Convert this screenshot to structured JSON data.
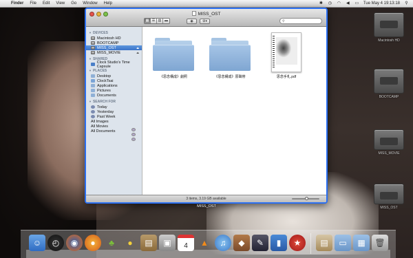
{
  "menubar": {
    "apple": "",
    "items": [
      "Finder",
      "File",
      "Edit",
      "View",
      "Go",
      "Window",
      "Help"
    ],
    "clock": "Tue May 4  19:13:18"
  },
  "window": {
    "title": "MISS_OST",
    "search_placeholder": "",
    "status": "3 items, 3.19 GB available",
    "zoom_level": 0.55
  },
  "sidebar": {
    "sections": [
      {
        "title": "DEVICES",
        "items": [
          {
            "label": "Macintosh HD",
            "icon": "disk-icon"
          },
          {
            "label": "BOOTCAMP",
            "icon": "disk-icon"
          },
          {
            "label": "MISS_OST",
            "icon": "disk-icon",
            "selected": true,
            "eject": true
          },
          {
            "label": "MISS_MOVIE",
            "icon": "disk-icon",
            "eject": true
          }
        ]
      },
      {
        "title": "SHARED",
        "items": [
          {
            "label": "Clock Studio's Time Capsule",
            "icon": "network-icon"
          }
        ]
      },
      {
        "title": "PLACES",
        "items": [
          {
            "label": "Desktop",
            "icon": "folder-icon"
          },
          {
            "label": "ClockTsai",
            "icon": "home-icon"
          },
          {
            "label": "Applications",
            "icon": "folder-icon"
          },
          {
            "label": "Pictures",
            "icon": "folder-icon"
          },
          {
            "label": "Documents",
            "icon": "folder-icon"
          }
        ]
      },
      {
        "title": "SEARCH FOR",
        "items": [
          {
            "label": "Today",
            "icon": "clock-icon"
          },
          {
            "label": "Yesterday",
            "icon": "clock-icon"
          },
          {
            "label": "Past Week",
            "icon": "clock-icon"
          },
          {
            "label": "All Images",
            "icon": "smart-folder-icon"
          },
          {
            "label": "All Movies",
            "icon": "smart-folder-icon"
          },
          {
            "label": "All Documents",
            "icon": "smart-folder-icon"
          }
        ]
      }
    ]
  },
  "files": [
    {
      "name": "《思念構成》劇照",
      "type": "folder"
    },
    {
      "name": "《思念構成》原聲帶",
      "type": "folder"
    },
    {
      "name": "思念手札.pdf",
      "type": "pdf"
    }
  ],
  "desktop": {
    "window_label": "MISS_OST",
    "disks": [
      {
        "label": "Macintosh HD"
      },
      {
        "label": "BOOTCAMP"
      },
      {
        "label": "MISS_MOVIE"
      },
      {
        "label": "MISS_OST"
      }
    ]
  },
  "dock": {
    "apps": [
      "finder-icon",
      "dashboard-icon",
      "firefox-icon",
      "beach-ball-icon",
      "android-icon",
      "duck-icon",
      "notebook-icon",
      "photos-icon",
      "calendar-icon",
      "vlc-icon",
      "itunes-icon",
      "keynote-icon",
      "pen-icon",
      "chart-icon",
      "star-icon"
    ],
    "calendar_day": "4",
    "stacks": [
      "documents-stack-icon",
      "downloads-stack-icon",
      "applications-stack-icon",
      "trash-icon"
    ]
  }
}
